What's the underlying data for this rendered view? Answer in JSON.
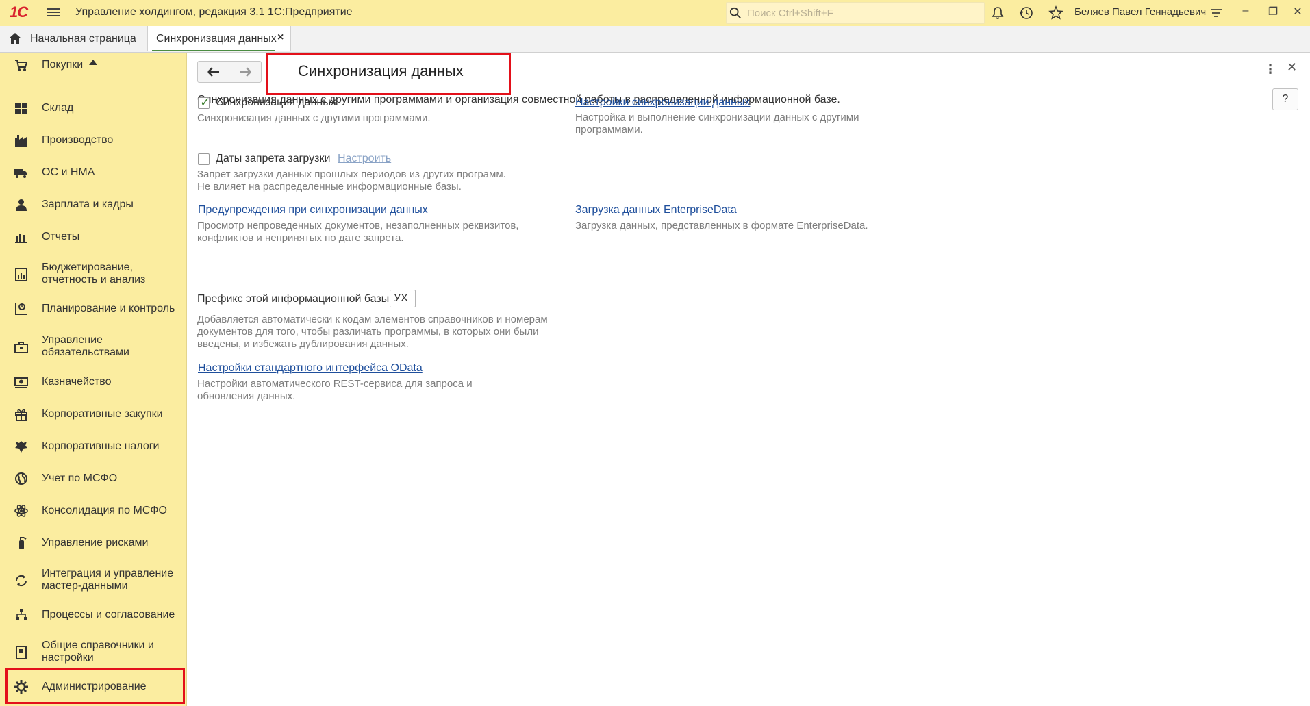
{
  "topbar": {
    "logo": "1С",
    "title": "Управление холдингом, редакция 3.1 1С:Предприятие",
    "search_placeholder": "Поиск Ctrl+Shift+F",
    "user": "Беляев Павел Геннадьевич"
  },
  "tabs": {
    "home": "Начальная страница",
    "active": "Синхронизация данных",
    "close": "×"
  },
  "sidebar": {
    "items": [
      {
        "label": "Покупки",
        "icon": "cart-icon"
      },
      {
        "label": "Склад",
        "icon": "warehouse-icon"
      },
      {
        "label": "Производство",
        "icon": "factory-icon"
      },
      {
        "label": "ОС и НМА",
        "icon": "truck-icon"
      },
      {
        "label": "Зарплата и кадры",
        "icon": "person-icon"
      },
      {
        "label": "Отчеты",
        "icon": "bar-chart-icon"
      },
      {
        "label": "Бюджетирование, отчетность и анализ",
        "icon": "budget-icon"
      },
      {
        "label": "Планирование и контроль",
        "icon": "planning-icon"
      },
      {
        "label": "Управление обязательствами",
        "icon": "briefcase-icon"
      },
      {
        "label": "Казначейство",
        "icon": "money-icon"
      },
      {
        "label": "Корпоративные закупки",
        "icon": "gift-icon"
      },
      {
        "label": "Корпоративные налоги",
        "icon": "emblem-icon"
      },
      {
        "label": "Учет по МСФО",
        "icon": "globe-icon"
      },
      {
        "label": "Консолидация по МСФО",
        "icon": "atom-icon"
      },
      {
        "label": "Управление рисками",
        "icon": "extinguisher-icon"
      },
      {
        "label": "Интеграция и управление мастер-данными",
        "icon": "sync-icon"
      },
      {
        "label": "Процессы и согласование",
        "icon": "process-icon"
      },
      {
        "label": "Общие справочники и настройки",
        "icon": "book-icon"
      },
      {
        "label": "Администрирование",
        "icon": "gear-icon"
      }
    ]
  },
  "main": {
    "title": "Синхронизация данных",
    "help": "?",
    "description": "Синхронизация данных с другими программами и организация совместной работы в распределенной информационной базе.",
    "sync_checkbox": {
      "label": "Синхронизация данных",
      "checked": true,
      "hint": "Синхронизация данных с другими программами."
    },
    "sync_settings": {
      "link": "Настройки синхронизации данных",
      "hint_line1": "Настройка и выполнение синхронизации данных с другими",
      "hint_line2": "программами."
    },
    "dates_checkbox": {
      "label": "Даты запрета загрузки",
      "checked": false,
      "link": "Настроить",
      "hint_line1": "Запрет загрузки данных прошлых периодов из других программ.",
      "hint_line2": "Не влияет на распределенные информационные базы."
    },
    "warnings": {
      "link": "Предупреждения при синхронизации данных",
      "hint_line1": "Просмотр непроведенных документов, незаполненных реквизитов,",
      "hint_line2": "конфликтов и непринятых по дате запрета."
    },
    "enterprise_data": {
      "link": "Загрузка данных EnterpriseData",
      "hint": "Загрузка данных, представленных в формате EnterpriseData."
    },
    "prefix": {
      "label": "Префикс этой информационной базы:",
      "value": "УХ",
      "hint_line1": "Добавляется автоматически к кодам элементов справочников и номерам",
      "hint_line2": "документов для того, чтобы различать программы, в которых они были",
      "hint_line3": "введены, и избежать дублирования данных."
    },
    "odata": {
      "link": "Настройки стандартного интерфейса OData",
      "hint_line1": "Настройки автоматического REST-сервиса для запроса и",
      "hint_line2": "обновления данных."
    }
  },
  "colors": {
    "accent_panel": "#fbeda0",
    "highlight_frame": "#e3101a",
    "link": "#1f4f9c",
    "check": "#3a7d2c"
  }
}
